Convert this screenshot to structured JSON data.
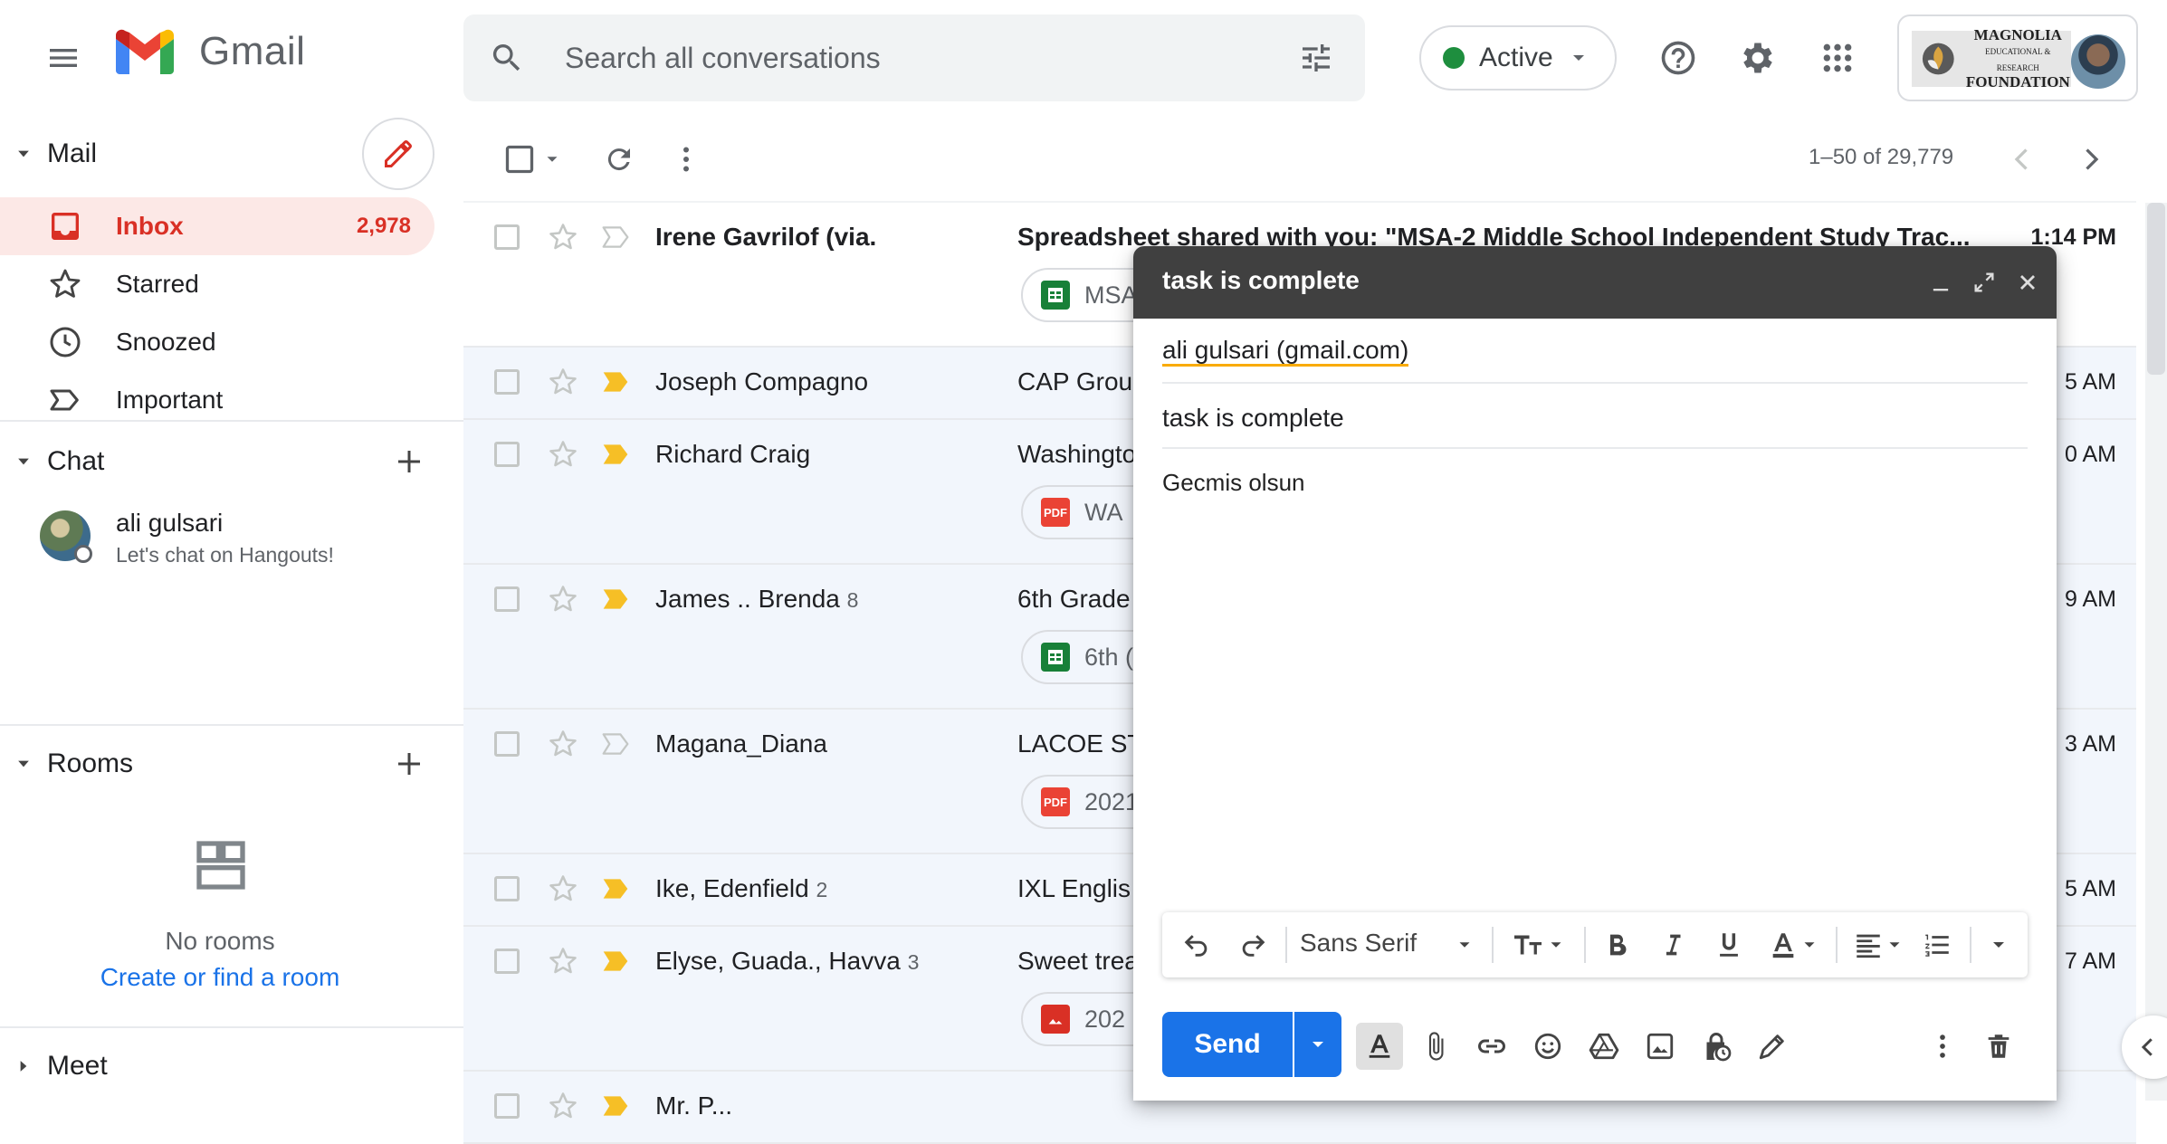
{
  "header": {
    "app_name": "Gmail",
    "search_placeholder": "Search all conversations",
    "status_label": "Active",
    "org_name": "MAGNOLIA\nEDUCATIONAL & RESEARCH\nFOUNDATION"
  },
  "sidebar": {
    "mail_section": "Mail",
    "nav": [
      {
        "label": "Inbox",
        "count": "2,978",
        "icon": "inbox-icon"
      },
      {
        "label": "Starred",
        "icon": "star-icon"
      },
      {
        "label": "Snoozed",
        "icon": "clock-icon"
      },
      {
        "label": "Important",
        "icon": "important-icon"
      }
    ],
    "chat_section": "Chat",
    "chat_contact": {
      "name": "ali gulsari",
      "status": "Let's chat on Hangouts!"
    },
    "rooms_section": "Rooms",
    "no_rooms": "No rooms",
    "create_room": "Create or find a room",
    "meet_section": "Meet"
  },
  "toolbar": {
    "pager": "1–50 of 29,779"
  },
  "mail": {
    "rows": [
      {
        "sender": "Irene Gavrilof (via.",
        "subject": "Spreadsheet shared with you: \"MSA-2 Middle School Independent Study Trac...",
        "time": "1:14 PM",
        "chip": "MSA",
        "chip_type": "sheet",
        "unread": true,
        "important": false
      },
      {
        "sender": "Joseph Compagno",
        "subject": "CAP Group",
        "time": "5 AM",
        "important": true
      },
      {
        "sender": "Richard Craig",
        "subject": "Washingto",
        "time": "0 AM",
        "chip": "WA",
        "chip_type": "pdf",
        "important": true
      },
      {
        "sender": "James .. Brenda",
        "count": "8",
        "subject": "6th Grade",
        "time": "9 AM",
        "chip": "6th (",
        "chip_type": "sheet",
        "important": true
      },
      {
        "sender": "Magana_Diana",
        "subject": "LACOE ST",
        "time": "3 AM",
        "chip": "2021",
        "chip_type": "pdf",
        "important": false
      },
      {
        "sender": "Ike, Edenfield",
        "count": "2",
        "subject": "IXL Englis",
        "time": "5 AM",
        "important": true
      },
      {
        "sender": "Elyse, Guada., Havva",
        "count": "3",
        "subject": "Sweet trea",
        "time": "7 AM",
        "chip": "202",
        "chip_type": "image",
        "important": true
      },
      {
        "sender": "Mr. P...",
        "subject": "",
        "time": "",
        "important": true
      }
    ]
  },
  "compose": {
    "title": "task is complete",
    "to": "ali gulsari (gmail.com)",
    "subject": "task is complete",
    "body": "Gecmis olsun",
    "font": "Sans Serif",
    "send_label": "Send"
  },
  "colors": {
    "accent": "#1a73e8",
    "inbox_active": "#d93025",
    "important_marker": "#f6bf26",
    "status_green": "#1e8e3e"
  }
}
